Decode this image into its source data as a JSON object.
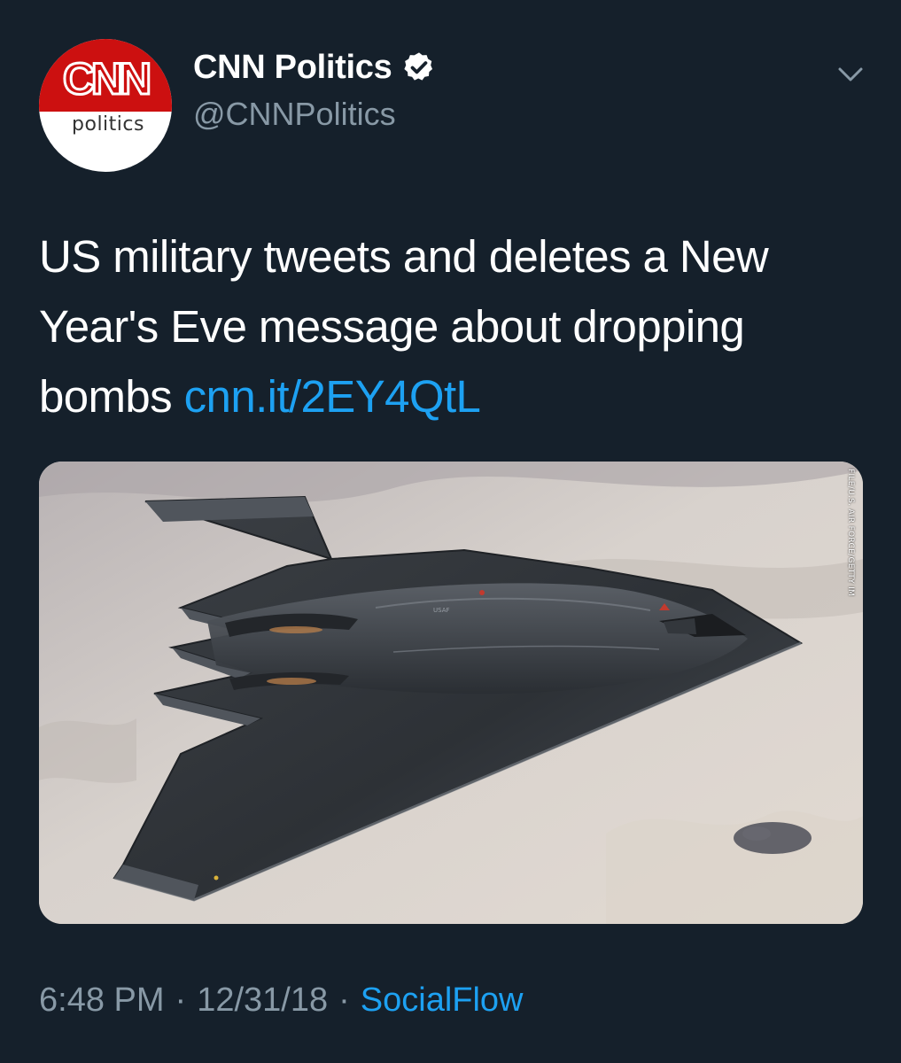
{
  "author": {
    "display_name": "CNN Politics",
    "handle": "@CNNPolitics",
    "verified": true,
    "avatar": {
      "logo_text": "CNN",
      "sub_text": "politics",
      "brand_color": "#cc1010"
    }
  },
  "tweet": {
    "text": "US military tweets and deletes a New Year's Eve message about dropping bombs ",
    "link_text": "cnn.it/2EY4QtL"
  },
  "media": {
    "description_icon": "b2-stealth-bomber-photo",
    "credit": "FILE/U.S. AIR FORCE/GETTY IM"
  },
  "meta": {
    "time": "6:48 PM",
    "separator": "·",
    "date": "12/31/18",
    "source": "SocialFlow"
  },
  "colors": {
    "background": "#15202b",
    "text": "#ffffff",
    "secondary": "#8899a6",
    "link": "#1da1f2"
  },
  "icons": {
    "menu": "chevron-down-icon",
    "verified": "verified-badge-icon"
  }
}
